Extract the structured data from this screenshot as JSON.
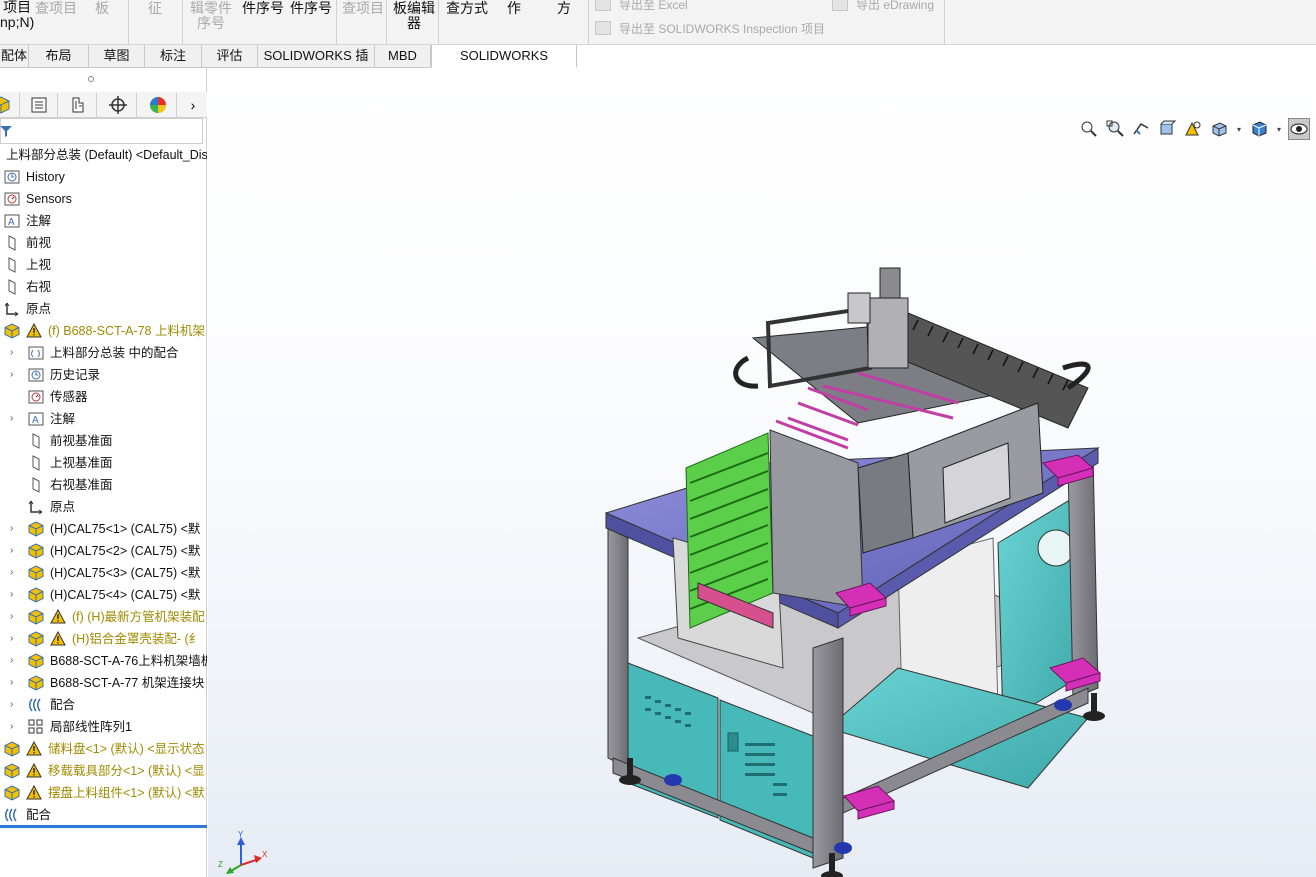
{
  "ribbon": {
    "buttons": [
      {
        "label": "项目\nnp;N)",
        "disabled": false
      },
      {
        "label": "查项目",
        "disabled": true
      },
      {
        "label": "板",
        "disabled": true
      },
      {
        "label": "征",
        "disabled": true
      },
      {
        "label": "辑零件\n序号",
        "disabled": true
      },
      {
        "label": "件序号",
        "disabled": false
      },
      {
        "label": "件序号",
        "disabled": false
      },
      {
        "label": "查项目",
        "disabled": true
      },
      {
        "label": "板编辑\n器",
        "disabled": false
      },
      {
        "label": "查方式",
        "disabled": false
      },
      {
        "label": "作",
        "disabled": false
      },
      {
        "label": "方",
        "disabled": false
      }
    ],
    "export_excel": "导出至 Excel",
    "export_solidworks": "导出至 SOLIDWORKS Inspection 项目",
    "export_edrawing": "导出 eDrawing"
  },
  "tabs": [
    "配体",
    "布局",
    "草图",
    "标注",
    "评估",
    "SOLIDWORKS 插件",
    "MBD",
    "SOLIDWORKS Inspection"
  ],
  "sidebar": {
    "root_label": "上料部分总装 (Default) <Default_Dis",
    "rows": [
      {
        "text": "History",
        "icon": "history-folder-icon"
      },
      {
        "text": "Sensors",
        "icon": "sensor-icon"
      },
      {
        "text": "注解",
        "icon": "annotation-icon"
      },
      {
        "text": "前视",
        "icon": "plane-icon"
      },
      {
        "text": "上视",
        "icon": "plane-icon"
      },
      {
        "text": "右视",
        "icon": "plane-icon"
      },
      {
        "text": "原点",
        "icon": "origin-icon"
      },
      {
        "text": "(f) B688-SCT-A-78 上料机架",
        "icon": "part-icon",
        "warn": true
      },
      {
        "text": "上料部分总装 中的配合",
        "icon": "mates-folder-icon"
      },
      {
        "text": "历史记录",
        "icon": "history-folder-icon"
      },
      {
        "text": "传感器",
        "icon": "sensor-icon"
      },
      {
        "text": "注解",
        "icon": "annotation-icon"
      },
      {
        "text": "前视基准面",
        "icon": "plane-icon"
      },
      {
        "text": "上视基准面",
        "icon": "plane-icon"
      },
      {
        "text": "右视基准面",
        "icon": "plane-icon"
      },
      {
        "text": "原点",
        "icon": "origin-icon"
      },
      {
        "text": "(H)CAL75<1> (CAL75) <默",
        "icon": "part-icon"
      },
      {
        "text": "(H)CAL75<2> (CAL75) <默",
        "icon": "part-icon"
      },
      {
        "text": "(H)CAL75<3> (CAL75) <默",
        "icon": "part-icon"
      },
      {
        "text": "(H)CAL75<4> (CAL75) <默",
        "icon": "part-icon"
      },
      {
        "text": "(f)  (H)最新方管机架装配",
        "icon": "part-icon",
        "warn": true
      },
      {
        "text": "(H)铝合金罩壳装配- (纟",
        "icon": "part-icon",
        "warn": true
      },
      {
        "text": "B688-SCT-A-76上料机架墙板",
        "icon": "part-icon"
      },
      {
        "text": "B688-SCT-A-77 机架连接块",
        "icon": "part-icon"
      },
      {
        "text": "配合",
        "icon": "mates-icon"
      },
      {
        "text": "局部线性阵列1",
        "icon": "pattern-icon"
      },
      {
        "text": "储料盘<1> (默认) <显示状态",
        "icon": "part-icon",
        "warn": true
      },
      {
        "text": "移载载具部分<1> (默认) <显",
        "icon": "part-icon",
        "warn": true
      },
      {
        "text": "摆盘上料组件<1> (默认) <默",
        "icon": "part-icon",
        "warn": true
      },
      {
        "text": "配合",
        "icon": "mates-icon"
      }
    ]
  },
  "heads_up_toolbar": [
    "zoom-to-fit-icon",
    "zoom-area-icon",
    "previous-view-icon",
    "section-view-icon",
    "dynamic-annotation-icon",
    "view-orientation-icon",
    "display-style-icon",
    "hide-show-icon",
    "edit-appearance-icon",
    "apply-scene-icon",
    "view-settings-icon"
  ],
  "colors": {
    "accent": "#2b7ad6",
    "warning": "#f2c200",
    "frame": "#7a7a82",
    "purple": "#6e6fc3",
    "teal": "#4bb7b7",
    "green": "#49c43b",
    "magenta": "#d42fb6"
  },
  "triad": {
    "x": "X",
    "y": "Y",
    "z": "Z"
  }
}
